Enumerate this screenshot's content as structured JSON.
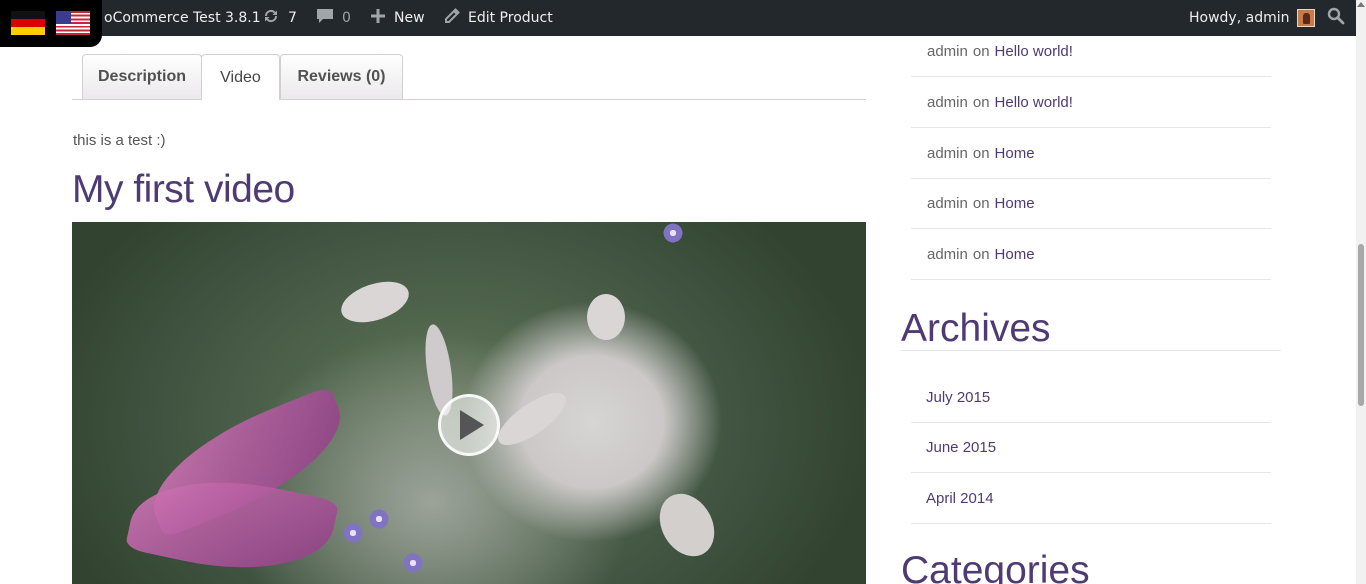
{
  "admin_bar": {
    "site_name": "oCommerce Test 3.8.1",
    "updates_count": "7",
    "comments_count": "0",
    "new_label": "New",
    "edit_label": "Edit Product",
    "howdy_label": "Howdy, admin",
    "icons": {
      "updates": "refresh-icon",
      "comments": "comment-icon",
      "new": "plus-icon",
      "edit": "pencil-icon",
      "search": "search-icon"
    }
  },
  "language_switcher": {
    "flags": [
      "german-flag",
      "us-flag"
    ]
  },
  "tabs": [
    {
      "label": "Description",
      "active": false
    },
    {
      "label": "Video",
      "active": true
    },
    {
      "label": "Reviews (0)",
      "active": false
    }
  ],
  "content": {
    "text": "this is a test :)",
    "video_title": "My first video"
  },
  "recent_comments": [
    {
      "author": "admin",
      "on": "on",
      "post": "Hello world!"
    },
    {
      "author": "admin",
      "on": "on",
      "post": "Hello world!"
    },
    {
      "author": "admin",
      "on": "on",
      "post": "Home"
    },
    {
      "author": "admin",
      "on": "on",
      "post": "Home"
    },
    {
      "author": "admin",
      "on": "on",
      "post": "Home"
    }
  ],
  "archives": {
    "title": "Archives",
    "items": [
      "July 2015",
      "June 2015",
      "April 2014"
    ]
  },
  "categories": {
    "title": "Categories"
  },
  "colors": {
    "accent": "#4e3b73",
    "admin_bar": "#23282d"
  }
}
